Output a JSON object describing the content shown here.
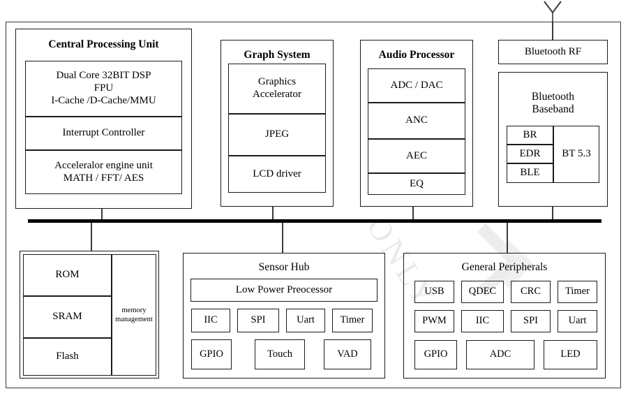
{
  "diagram": {
    "title_semantic": "soc-block-diagram",
    "watermark_text": "ONLY",
    "bus_label": "system-bus"
  },
  "cpu": {
    "title": "Central Processing Unit",
    "blocks": [
      {
        "text": "Dual Core 32BIT DSP\nFPU\nI-Cache /D-Cache/MMU"
      },
      {
        "text": "Interrupt Controller"
      },
      {
        "text": "Accelerator engine unit\nMATH / FFT/ AES"
      }
    ],
    "block_lines": [
      [
        "Dual Core 32BIT DSP",
        "FPU",
        "I-Cache /D-Cache/MMU"
      ],
      [
        "Interrupt Controller"
      ],
      [
        "Acceleralor engine unit",
        "MATH / FFT/ AES"
      ]
    ]
  },
  "graph_system": {
    "title": "Graph System",
    "blocks": [
      "Graphics Accelerator",
      "JPEG",
      "LCD driver"
    ],
    "block_lines": [
      [
        "Graphics",
        "Accelerator"
      ],
      [
        "JPEG"
      ],
      [
        "LCD driver"
      ]
    ]
  },
  "audio_processor": {
    "title": "Audio Processor",
    "blocks": [
      "ADC / DAC",
      "ANC",
      "AEC",
      "EQ"
    ]
  },
  "bluetooth": {
    "rf_label": "Bluetooth RF",
    "baseband_lines": [
      "Bluetooth",
      "Baseband"
    ],
    "modes": [
      "BR",
      "EDR",
      "BLE"
    ],
    "version": "BT 5.3",
    "antenna_icon": "antenna-icon"
  },
  "memory": {
    "blocks": [
      "ROM",
      "SRAM",
      "Flash"
    ],
    "management_lines": [
      "memory",
      "management"
    ]
  },
  "sensor_hub": {
    "title": "Sensor Hub",
    "processor": "Low Power Preocessor",
    "row1": [
      "IIC",
      "SPI",
      "Uart",
      "Timer"
    ],
    "row2": [
      "GPIO",
      "Touch",
      "VAD"
    ]
  },
  "general_peripherals": {
    "title": "General Peripherals",
    "row1": [
      "USB",
      "QDEC",
      "CRC",
      "Timer"
    ],
    "row2": [
      "PWM",
      "IIC",
      "SPI",
      "Uart"
    ],
    "row3": [
      "GPIO",
      "ADC",
      "LED"
    ]
  },
  "colors": {
    "line": "#1a1a1a",
    "frame": "#3a3a3a",
    "bus": "#000000",
    "watermark": "#d9d9d9",
    "background": "#ffffff"
  }
}
